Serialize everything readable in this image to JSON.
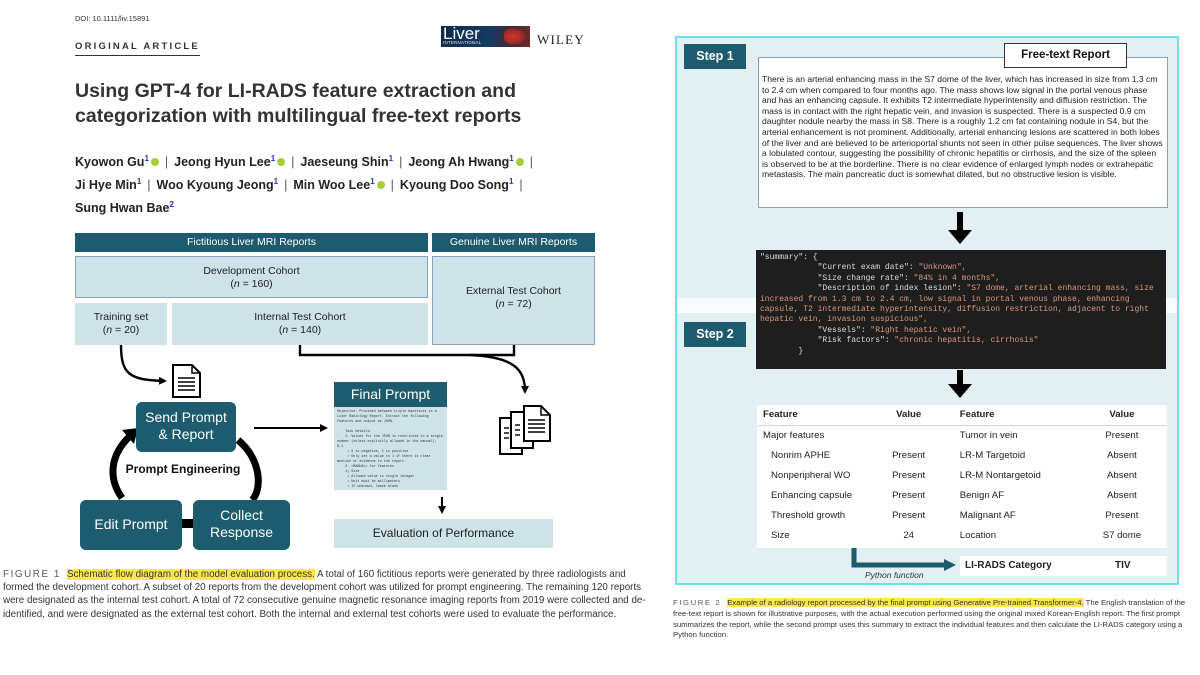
{
  "header": {
    "doi": "DOI: 10.1111/liv.15891",
    "article_type": "ORIGINAL ARTICLE",
    "journal_logo_line1": "Liver",
    "journal_logo_line2": "INTERNATIONAL",
    "publisher": "WILEY"
  },
  "paper": {
    "title": "Using GPT-4 for LI-RADS feature extraction and categorization with multilingual free-text reports",
    "authors": [
      {
        "name": "Kyowon Gu",
        "aff": "1",
        "orcid": true
      },
      {
        "name": "Jeong Hyun Lee",
        "aff": "1",
        "orcid": true
      },
      {
        "name": "Jaeseung Shin",
        "aff": "1",
        "orcid": false
      },
      {
        "name": "Jeong Ah Hwang",
        "aff": "1",
        "orcid": true
      },
      {
        "name": "Ji Hye Min",
        "aff": "1",
        "orcid": false
      },
      {
        "name": "Woo Kyoung Jeong",
        "aff": "1",
        "orcid": false
      },
      {
        "name": "Min Woo Lee",
        "aff": "1",
        "orcid": true
      },
      {
        "name": "Kyoung Doo Song",
        "aff": "1",
        "orcid": false
      },
      {
        "name": "Sung Hwan Bae",
        "aff": "2",
        "orcid": false
      }
    ]
  },
  "figure1": {
    "header_fictitious": "Fictitious Liver MRI Reports",
    "header_genuine": "Genuine Liver MRI Reports",
    "development": {
      "label": "Development Cohort",
      "n": "160"
    },
    "training": {
      "label": "Training set",
      "n": "20"
    },
    "internal": {
      "label": "Internal Test Cohort",
      "n": "140"
    },
    "external": {
      "label": "External Test Cohort",
      "n": "72"
    },
    "n_prefix": "n",
    "n_eq": " = ",
    "cycle_label": "Prompt Engineering",
    "stage_send_line1": "Send Prompt",
    "stage_send_line2": "& Report",
    "stage_edit": "Edit Prompt",
    "stage_collect_line1": "Collect",
    "stage_collect_line2": "Response",
    "final_prompt_title": "Final Prompt",
    "final_prompt_body": "Objective: Provided between triple backticks is a Liver Radiology Report. Extract the following features and output as JSON.\n\n    Task details:\n    1. Values for the JSON is restricted to a single number (unless explicitly allowed in the manual): 0,1\n     • 0 is negative, 1 is positive\n     • Only set a value to 1 if there is clear mention or evidence in the report.\n    2. <MANUAL> for features\n    1) Size\n     • Allowed value is single integer\n     • Unit must be millimeters\n     • If unknown, leave blank",
    "evaluation": "Evaluation of Performance",
    "caption_label": "FIGURE 1",
    "caption_highlight": "Schematic flow diagram of the model evaluation process.",
    "caption_text": " A total of 160 fictitious reports were generated by three radiologists and formed the development cohort. A subset of 20 reports from the development cohort was utilized for prompt engineering. The remaining 120 reports were designated as the internal test cohort. A total of 72 consecutive genuine magnetic resonance imaging reports from 2019 were collected and de-identified, and were designated as the external test cohort. Both the internal and external test cohorts were used to evaluate the performance."
  },
  "figure2": {
    "step1": "Step 1",
    "step2": "Step 2",
    "report_title": "Free-text Report",
    "report_text": "There is an arterial enhancing mass in the S7 dome of the liver, which has increased in size from 1.3 cm to 2.4 cm when compared to four months ago. The mass shows low signal in the portal venous phase and has an enhancing capsule. It exhibits T2 intermediate hyperintensity and diffusion restriction. The mass is in contact with the right hepatic vein, and invasion is suspected. There is a suspected 0.9 cm daughter nodule nearby the mass in S8. There is a roughly 1.2 cm fat containing nodule in S4, but the arterial enhancement is not prominent. Additionally, arterial enhancing lesions are scattered in both lobes of the liver and are believed to be arterioportal shunts not seen in other pulse sequences. The liver shows a lobulated contour, suggesting the possibility of chronic hepatitis or cirrhosis, and the size of the spleen is observed to be at the borderline. There is no clear evidence of enlarged lymph nodes or extrahepatic metastasis. The main pancreatic duct is somewhat dilated, but no obstructive lesion is visible.",
    "summary_json": {
      "root_key": "\"summary\": {",
      "entries": [
        {
          "key": "\"Current exam date\": ",
          "value": "\"Unknown\","
        },
        {
          "key": "\"Size change rate\": ",
          "value": "\"84% in 4 months\","
        },
        {
          "key": "\"Description of index lesion\": ",
          "value": "\"S7 dome, arterial enhancing mass, size increased from 1.3 cm to 2.4 cm, low signal in portal venous phase, enhancing capsule, T2 intermediate hyperintensity, diffusion restriction, adjacent to right hepatic vein, invasion suspicious\","
        },
        {
          "key": "\"Vessels\": ",
          "value": "\"Right hepatic vein\","
        },
        {
          "key": "\"Risk factors\": ",
          "value": "\"chronic hepatitis, cirrhosis\""
        }
      ],
      "close": "}"
    },
    "table": {
      "headers": [
        "Feature",
        "Value",
        "Feature",
        "Value"
      ],
      "rows": [
        {
          "f1": "Major features",
          "v1": "",
          "f2": "Tumor in vein",
          "v2": "Present",
          "indent": false
        },
        {
          "f1": "Nonrim APHE",
          "v1": "Present",
          "f2": "LR-M Targetoid",
          "v2": "Absent",
          "indent": true
        },
        {
          "f1": "Nonperipheral WO",
          "v1": "Present",
          "f2": "LR-M Nontargetoid",
          "v2": "Absent",
          "indent": true
        },
        {
          "f1": "Enhancing capsule",
          "v1": "Present",
          "f2": "Benign AF",
          "v2": "Absent",
          "indent": true
        },
        {
          "f1": "Threshold growth",
          "v1": "Present",
          "f2": "Malignant AF",
          "v2": "Present",
          "indent": true
        },
        {
          "f1": "Size",
          "v1": "24",
          "f2": "Location",
          "v2": "S7 dome",
          "indent": true
        }
      ]
    },
    "python_label": "Python function",
    "category_label": "LI-RADS Category",
    "category_value": "TIV",
    "caption_label": "FIGURE 2",
    "caption_highlight": "Example of a radiology report processed by the final prompt using Generative Pre-trained Transformer-4.",
    "caption_text": " The English translation of the free-text report is shown for illustrative purposes, with the actual execution performed using the original mixed Korean-English report. The first prompt summarizes the report, while the second prompt uses this summary to extract the individual features and then calculate the LI-RADS category using a Python function."
  },
  "colors": {
    "teal": "#1d5c6e",
    "light_teal": "#cde3e8",
    "panel_bg": "#e2f0f3",
    "panel_border": "#6de0e6",
    "highlight": "#fde74c",
    "orcid": "#a6ce39",
    "affiliation": "#2433b8"
  }
}
